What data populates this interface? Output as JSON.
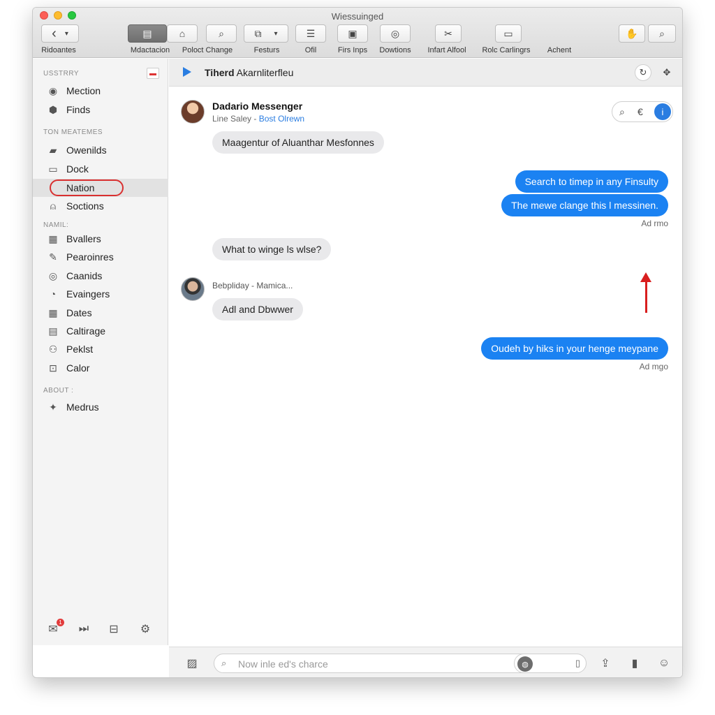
{
  "window": {
    "title": "Wiessuinged"
  },
  "toolbar": {
    "buttons": [
      {
        "icon": "back-forward-icon",
        "glyph_left": "‹",
        "glyph_right": "▾",
        "label": "Ridoantes"
      },
      {
        "icon": "media-icon",
        "glyph": "▤",
        "label": "Mdactacion"
      },
      {
        "icon": "home-icon",
        "glyph": "⌂",
        "label": "Poloct Change"
      },
      {
        "icon": "search-icon",
        "glyph": "⌕",
        "label": "Festurs"
      },
      {
        "icon": "attach-icon",
        "glyph": "⧉",
        "glyph_right": "▾",
        "label": "Ofil"
      },
      {
        "icon": "list-icon",
        "glyph": "☰",
        "label": "Firs Inps"
      },
      {
        "icon": "share-icon",
        "glyph": "▣",
        "label": "Dowtions"
      },
      {
        "icon": "location-icon",
        "glyph": "◎",
        "label": "Infart Alfool"
      },
      {
        "icon": "tools-icon",
        "glyph": "✂",
        "label": "Rolc Carlingrs"
      },
      {
        "icon": "display-icon",
        "glyph": "▭",
        "label": "Achent"
      }
    ],
    "right_icons": [
      {
        "icon": "hand-icon",
        "glyph": "✋"
      },
      {
        "icon": "search-icon",
        "glyph": "⌕"
      }
    ]
  },
  "sidebar": {
    "sections": [
      {
        "header": "USSTRRY",
        "items": [
          {
            "icon": "globe-icon",
            "glyph": "◉",
            "label": "Mection"
          },
          {
            "icon": "shield-icon",
            "glyph": "⬢",
            "label": "Finds"
          }
        ]
      },
      {
        "header": "TON MEATEMES",
        "items": [
          {
            "icon": "folder-icon",
            "glyph": "▰",
            "label": "Owenilds"
          },
          {
            "icon": "dock-icon",
            "glyph": "▭",
            "label": "Dock"
          },
          {
            "icon": "nation-icon",
            "glyph": "",
            "label": "Nation",
            "selected": true
          },
          {
            "icon": "person-icon",
            "glyph": "⍝",
            "label": "Soctions"
          }
        ]
      },
      {
        "header": "NAMIL:",
        "items": [
          {
            "icon": "grid-icon",
            "glyph": "▦",
            "label": "Bvallers"
          },
          {
            "icon": "pen-icon",
            "glyph": "✎",
            "label": "Pearoinres"
          },
          {
            "icon": "target-icon",
            "glyph": "◎",
            "label": "Caanids"
          },
          {
            "icon": "speed-icon",
            "glyph": "◔",
            "label": "Evaingers"
          },
          {
            "icon": "calendar-icon",
            "glyph": "▦",
            "label": "Dates"
          },
          {
            "icon": "document-icon",
            "glyph": "▤",
            "label": "Caltirage"
          },
          {
            "icon": "user-icon",
            "glyph": "⚇",
            "label": "Peklst"
          },
          {
            "icon": "lock-icon",
            "glyph": "⊡",
            "label": "Calor"
          }
        ]
      },
      {
        "header": "ABOUT :",
        "items": [
          {
            "icon": "star-icon",
            "glyph": "✦",
            "label": "Medrus"
          }
        ]
      }
    ],
    "footer_icons": [
      {
        "icon": "notification-icon",
        "glyph": "✉",
        "badge": "1"
      },
      {
        "icon": "skip-icon",
        "glyph": "⏭"
      },
      {
        "icon": "inbox-icon",
        "glyph": "⊟"
      },
      {
        "icon": "settings-icon",
        "glyph": "⚙"
      }
    ]
  },
  "conversation": {
    "header_bold": "Tiherd",
    "header_rest": "Akarnliterfleu",
    "header_icons": [
      {
        "icon": "sync-icon",
        "glyph": "↻"
      },
      {
        "icon": "pin-icon",
        "glyph": "✥"
      }
    ],
    "contact": {
      "name": "Dadario Messenger",
      "sub": "Line Saley",
      "sub_sep": "-",
      "sub_link": "Bost Olrewn",
      "controls": [
        {
          "icon": "search-icon",
          "glyph": "⌕"
        },
        {
          "icon": "euro-icon",
          "glyph": "€"
        },
        {
          "icon": "info-icon",
          "glyph": "i"
        }
      ]
    },
    "messages": [
      {
        "dir": "in",
        "text": "Maagentur of Aluanthar Mesfonnes"
      },
      {
        "dir": "out",
        "text": "Search to timep in any Finsulty"
      },
      {
        "dir": "out",
        "text": "The mewe clange this l messinen."
      },
      {
        "stamp": "Ad rmo"
      },
      {
        "dir": "in",
        "text": "What to winge ls wlse?"
      },
      {
        "sender": "Bebpliday - Mamica..."
      },
      {
        "dir": "in",
        "text": "Adl and Dbwwer"
      },
      {
        "dir": "out",
        "text": "Oudeh by hiks in your henge meypane"
      },
      {
        "stamp": "Ad mgo"
      }
    ]
  },
  "composer": {
    "placeholder": "Now inle ed's charce",
    "left_icon": {
      "icon": "media-icon",
      "glyph": "▨"
    },
    "right_icons": [
      {
        "icon": "share-icon",
        "glyph": "⇪"
      },
      {
        "icon": "bookmark-icon",
        "glyph": "▮"
      },
      {
        "icon": "emoji-icon",
        "glyph": "☺"
      }
    ]
  },
  "colors": {
    "accent": "#1b82f2",
    "selection_ring": "#d93030",
    "arrow": "#d81e1e"
  }
}
